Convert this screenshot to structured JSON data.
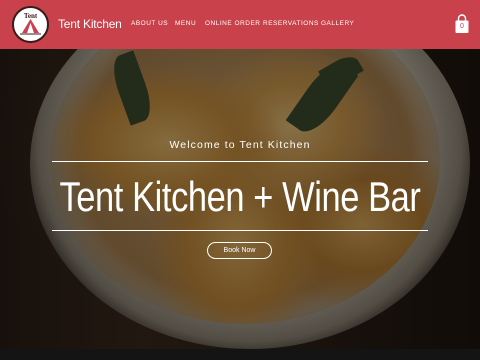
{
  "header": {
    "brand": "Tent Kitchen",
    "logo_text": "Tent",
    "nav": [
      {
        "label": "ABOUT US"
      },
      {
        "label": "MENU"
      },
      {
        "label": "ONLINE ORDER"
      },
      {
        "label": "RESERVATIONS"
      },
      {
        "label": "GALLERY"
      }
    ],
    "cart_count": "0",
    "cart_icon": "shopping-bag-icon",
    "background_color": "#c8414b"
  },
  "hero": {
    "welcome": "Welcome to Tent Kitchen",
    "headline": "Tent Kitchen + Wine Bar",
    "button_label": "Book Now"
  }
}
